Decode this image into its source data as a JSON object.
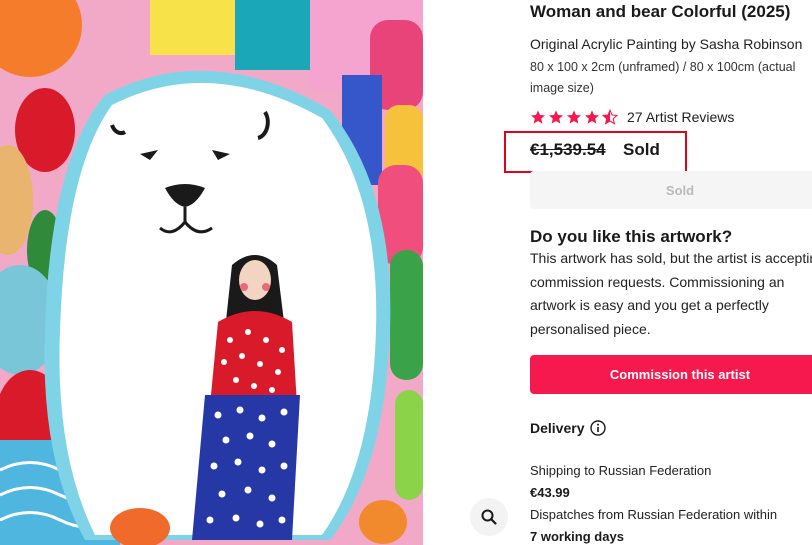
{
  "artwork": {
    "title": "Woman and bear Colorful (2025)",
    "subtitle": "Original Acrylic Painting by Sasha Robinson",
    "dimensions": "80 x 100 x 2cm (unframed) / 80 x 100cm (actual image size)"
  },
  "rating": {
    "stars": 4.5,
    "reviews_label": "27 Artist Reviews",
    "star_color": "#f6194e"
  },
  "price": {
    "original": "€1,539.54",
    "status": "Sold",
    "highlight_color": "#e3001b"
  },
  "sold_button": {
    "label": "Sold"
  },
  "interest": {
    "heading": "Do you like this artwork?",
    "body": "This artwork has sold, but the artist is accepting commission requests. Commissioning an artwork is easy and you get a perfectly personalised piece."
  },
  "commission_button": {
    "label": "Commission this artist",
    "color": "#f6194e"
  },
  "delivery": {
    "heading": "Delivery",
    "info_icon": "info-icon",
    "shipping_to": "Shipping to Russian Federation",
    "cost": "€43.99",
    "dispatch": "Dispatches from Russian Federation within",
    "days": "7 working days"
  },
  "image": {
    "zoom_icon": "zoom-icon"
  }
}
